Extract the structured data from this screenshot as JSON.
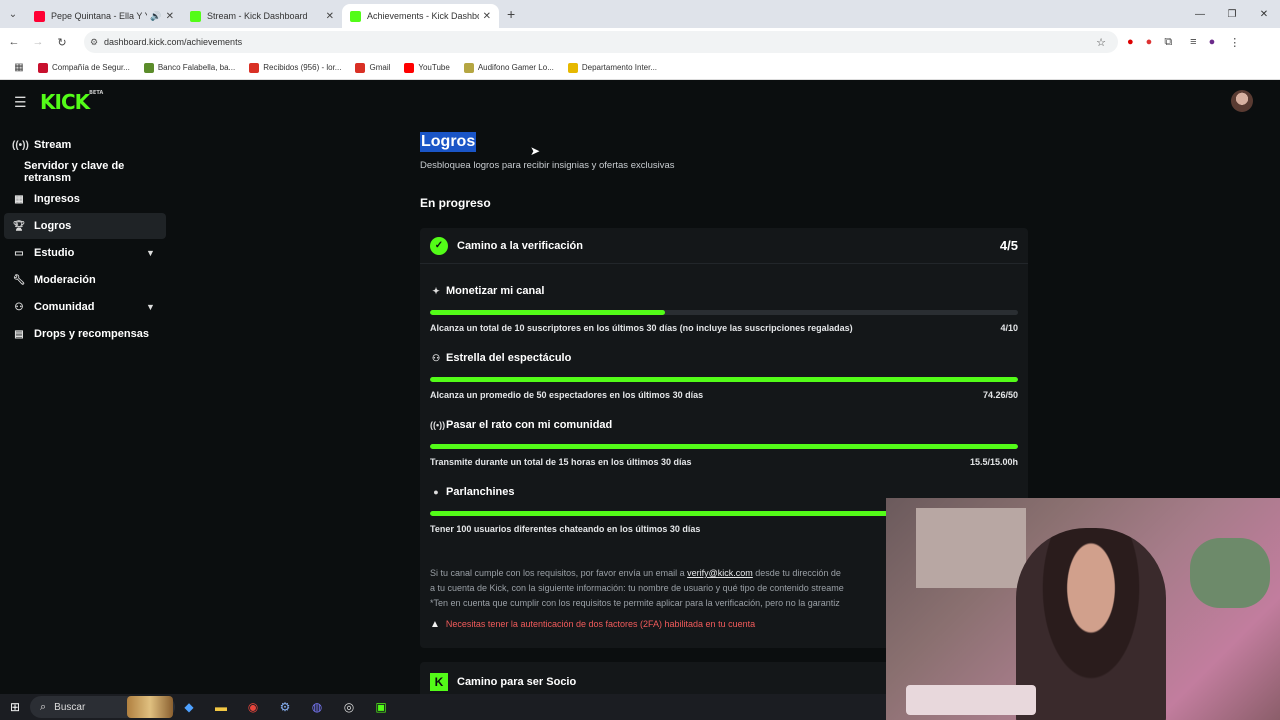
{
  "browser": {
    "tabs": [
      {
        "title": "Pepe Quintana - Ella Y Yo Remix",
        "favicon_color": "#ff0033"
      },
      {
        "title": "Stream - Kick Dashboard",
        "favicon_color": "#53fc18"
      },
      {
        "title": "Achievements - Kick Dashboard",
        "favicon_color": "#53fc18"
      }
    ],
    "new_tab": "+",
    "url": "dashboard.kick.com/achievements",
    "bookmarks": [
      {
        "label": "Compañía de Segur...",
        "color": "#c8102e"
      },
      {
        "label": "Banco Falabella, ba...",
        "color": "#5b8c2a"
      },
      {
        "label": "Recibidos (956) - lor...",
        "color": "#d93025"
      },
      {
        "label": "Gmail",
        "color": "#d93025"
      },
      {
        "label": "YouTube",
        "color": "#ff0000"
      },
      {
        "label": "Audifono Gamer Lo...",
        "color": "#b5a642"
      },
      {
        "label": "Departamento Inter...",
        "color": "#e6b800"
      }
    ]
  },
  "app": {
    "logo": "KICK",
    "logo_tag": "BETA",
    "sidebar": [
      {
        "label": "Stream",
        "icon": "broadcast-icon"
      },
      {
        "label": "Servidor y clave de retransm",
        "sub": true
      },
      {
        "label": "Ingresos",
        "icon": "wallet-icon"
      },
      {
        "label": "Logros",
        "icon": "trophy-icon",
        "active": true
      },
      {
        "label": "Estudio",
        "icon": "studio-icon",
        "expandable": true
      },
      {
        "label": "Moderación",
        "icon": "wrench-icon"
      },
      {
        "label": "Comunidad",
        "icon": "community-icon",
        "expandable": true
      },
      {
        "label": "Drops y recompensas",
        "icon": "gift-icon"
      }
    ],
    "page_title": "Logros",
    "page_subtitle": "Desbloquea logros para recibir insignias y ofertas exclusivas",
    "section_title": "En progreso",
    "card": {
      "title": "Camino a la verificación",
      "count": "4/5",
      "achievements": [
        {
          "title": "Monetizar mi canal",
          "icon": "sparkle-icon",
          "desc": "Alcanza un total de 10 suscriptores en los últimos 30 días (no incluye las suscripciones regaladas)",
          "value": "4/10",
          "progress": 0.4
        },
        {
          "title": "Estrella del espectáculo",
          "icon": "viewers-icon",
          "desc": "Alcanza un promedio de 50 espectadores en los últimos 30 días",
          "value": "74.26/50",
          "progress": 1.0
        },
        {
          "title": "Pasar el rato con mi comunidad",
          "icon": "broadcast-icon",
          "desc": "Transmite durante un total de 15 horas en los últimos 30 días",
          "value": "15.5/15.00h",
          "progress": 1.0
        },
        {
          "title": "Parlanchines",
          "icon": "chat-icon",
          "desc": "Tener 100 usuarios diferentes chateando en los últimos 30 días",
          "value": "",
          "progress": 1.0
        }
      ],
      "footer": {
        "line1_pre": "Si tu canal cumple con los requisitos, por favor envía un email a ",
        "email": "verify@kick.com",
        "line1_post": " desde tu dirección de",
        "line2": "a tu cuenta de Kick, con la siguiente información: tu nombre de usuario y qué tipo de contenido streame",
        "line3": "*Ten en cuenta que cumplir con los requisitos te permite aplicar para la verificación, pero no la garantiz",
        "warning": "Necesitas tener la autenticación de dos factores (2FA) habilitada en tu cuenta"
      }
    },
    "card2_title": "Camino para ser Socio"
  },
  "taskbar": {
    "search_label": "Buscar"
  },
  "colors": {
    "accent": "#53fc18",
    "background": "#0b0e0f",
    "card": "#141719",
    "warning": "#f25b5b"
  }
}
